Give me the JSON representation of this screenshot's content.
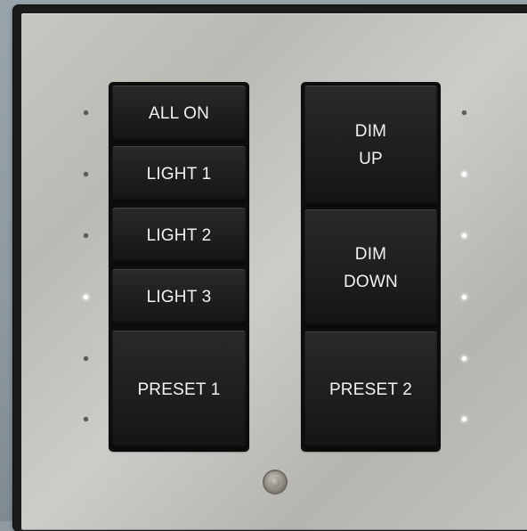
{
  "keypad": {
    "left_column": [
      {
        "label": "ALL ON",
        "led_on": false
      },
      {
        "label": "LIGHT 1",
        "led_on": false
      },
      {
        "label": "LIGHT 2",
        "led_on": false
      },
      {
        "label": "LIGHT 3",
        "led_on": true
      },
      {
        "label": "PRESET 1",
        "led_on": false
      }
    ],
    "right_column": [
      {
        "label": "DIM\nUP"
      },
      {
        "label": "DIM\nDOWN"
      },
      {
        "label": "PRESET 2"
      }
    ],
    "right_leds_on": [
      false,
      true,
      true,
      true,
      true,
      true
    ],
    "left_extra_led_on": false
  },
  "colors": {
    "plate": "#c4c3be",
    "button": "#1e1e1e",
    "label": "#f2f2f2",
    "led_off": "#5a5a58",
    "led_on": "#ffffff"
  }
}
